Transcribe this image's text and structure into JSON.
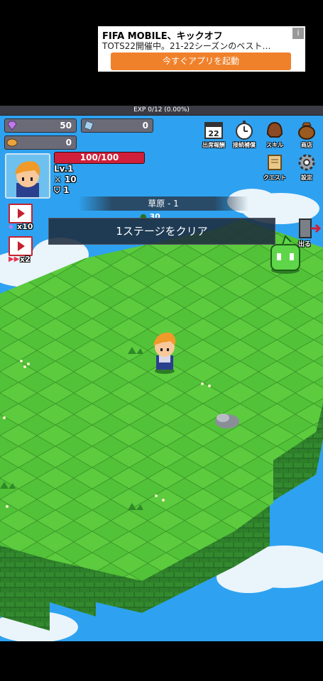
{
  "ad": {
    "title": "FIFA MOBILE、キックオフ",
    "text": "TOTS22開催中。21-22シーズンのベスト…",
    "cta": "今すぐアプリを起動",
    "info_icon": "i"
  },
  "exp": {
    "label": "EXP 0/12 (0.00%)",
    "fraction": 0
  },
  "resources": {
    "gems": "50",
    "crystals": "0",
    "coins": "0"
  },
  "player": {
    "hp": "100/100",
    "level": "Lv.1",
    "attack": "10",
    "defense": "1"
  },
  "menu": {
    "attendance": {
      "label": "出席報酬",
      "day": "22"
    },
    "connection": "接続補償",
    "skill": "スキル",
    "shop": "商店",
    "quest": "クエスト",
    "settings": "設定"
  },
  "video_buttons": {
    "gems_mult": "x10",
    "speed_mult": "x2"
  },
  "stage": {
    "name": "草原 - 1",
    "enemy_count": "30",
    "message": "1ステージをクリア"
  },
  "exit": {
    "label": "出る"
  },
  "colors": {
    "sky": "#2ea2f0",
    "grass_light": "#56c63a",
    "grass_dark": "#3aa12a",
    "hp_red": "#d01f3a",
    "ad_button": "#f0812b"
  }
}
